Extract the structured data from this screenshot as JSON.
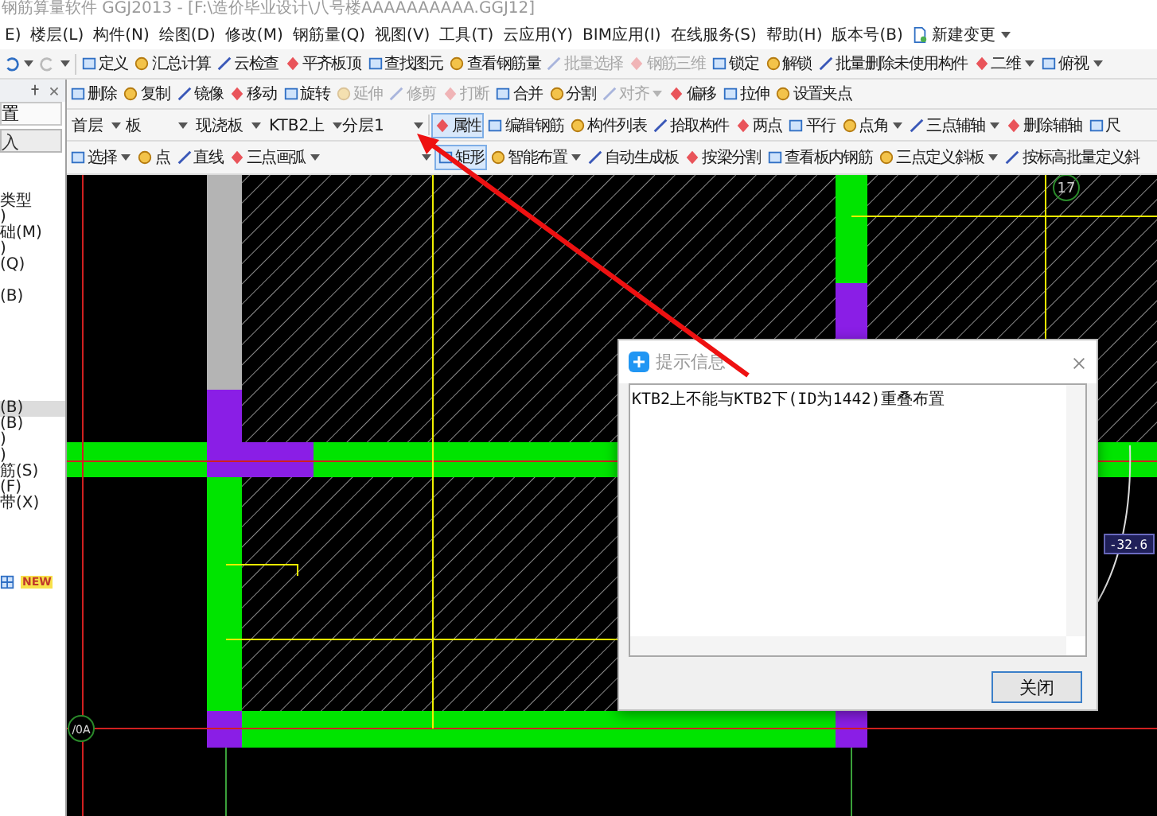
{
  "window": {
    "title": "钢筋算量软件 GGJ2013 - [F:\\造价毕业设计\\八号楼AAAAAAAAAA.GGJ12]"
  },
  "menu": [
    "E)",
    "楼层(L)",
    "构件(N)",
    "绘图(D)",
    "修改(M)",
    "钢筋量(Q)",
    "视图(V)",
    "工具(T)",
    "云应用(Y)",
    "BIM应用(I)",
    "在线服务(S)",
    "帮助(H)",
    "版本号(B)",
    "新建变更"
  ],
  "toolbar_main": [
    {
      "label": "定义",
      "disabled": false,
      "selected": false,
      "dropdown": false
    },
    {
      "label": "汇总计算",
      "disabled": false,
      "selected": false,
      "dropdown": false
    },
    {
      "label": "云检查",
      "disabled": false,
      "selected": false,
      "dropdown": false
    },
    {
      "label": "平齐板顶",
      "disabled": false,
      "selected": false,
      "dropdown": false
    },
    {
      "label": "查找图元",
      "disabled": false,
      "selected": false,
      "dropdown": false
    },
    {
      "label": "查看钢筋量",
      "disabled": false,
      "selected": false,
      "dropdown": false
    },
    {
      "label": "批量选择",
      "disabled": true,
      "selected": false,
      "dropdown": false
    },
    {
      "label": "钢筋三维",
      "disabled": true,
      "selected": false,
      "dropdown": false
    },
    {
      "label": "锁定",
      "disabled": false,
      "selected": false,
      "dropdown": false
    },
    {
      "label": "解锁",
      "disabled": false,
      "selected": false,
      "dropdown": false
    },
    {
      "label": "批量删除未使用构件",
      "disabled": false,
      "selected": false,
      "dropdown": false
    },
    {
      "label": "二维",
      "disabled": false,
      "selected": false,
      "dropdown": true
    },
    {
      "label": "俯视",
      "disabled": false,
      "selected": false,
      "dropdown": true
    }
  ],
  "panel": {
    "title": "置",
    "button": "入",
    "groups": [
      {
        "items": [
          {
            "label": "类型",
            "selected": false
          },
          {
            "label": ")",
            "selected": false
          },
          {
            "label": "础(M)",
            "selected": false
          },
          {
            "label": ")",
            "selected": false
          },
          {
            "label": "(Q)",
            "selected": false
          }
        ]
      },
      {
        "items": [
          {
            "label": "(B)",
            "selected": false
          }
        ]
      },
      {
        "items": [
          {
            "label": "(B)",
            "selected": true
          },
          {
            "label": "(B)",
            "selected": false
          },
          {
            "label": ")",
            "selected": false
          },
          {
            "label": ")",
            "selected": false
          },
          {
            "label": "筋(S)",
            "selected": false
          },
          {
            "label": "(F)",
            "selected": false
          },
          {
            "label": "带(X)",
            "selected": false
          }
        ]
      }
    ],
    "new_badge": "NEW"
  },
  "toolbar_edit": [
    {
      "label": "删除",
      "disabled": false,
      "selected": false,
      "dropdown": false
    },
    {
      "label": "复制",
      "disabled": false,
      "selected": false,
      "dropdown": false
    },
    {
      "label": "镜像",
      "disabled": false,
      "selected": false,
      "dropdown": false
    },
    {
      "label": "移动",
      "disabled": false,
      "selected": false,
      "dropdown": false
    },
    {
      "label": "旋转",
      "disabled": false,
      "selected": false,
      "dropdown": false
    },
    {
      "label": "延伸",
      "disabled": true,
      "selected": false,
      "dropdown": false
    },
    {
      "label": "修剪",
      "disabled": true,
      "selected": false,
      "dropdown": false
    },
    {
      "label": "打断",
      "disabled": true,
      "selected": false,
      "dropdown": false
    },
    {
      "label": "合并",
      "disabled": false,
      "selected": false,
      "dropdown": false
    },
    {
      "label": "分割",
      "disabled": false,
      "selected": false,
      "dropdown": false
    },
    {
      "label": "对齐",
      "disabled": true,
      "selected": false,
      "dropdown": true
    },
    {
      "label": "偏移",
      "disabled": false,
      "selected": false,
      "dropdown": false
    },
    {
      "label": "拉伸",
      "disabled": false,
      "selected": false,
      "dropdown": false
    },
    {
      "label": "设置夹点",
      "disabled": false,
      "selected": false,
      "dropdown": false
    }
  ],
  "selectors": [
    {
      "value": "首层"
    },
    {
      "value": "板"
    },
    {
      "value": "现浇板"
    },
    {
      "value": "KTB2上"
    },
    {
      "value": "分层1"
    }
  ],
  "toolbar_element": [
    {
      "label": "属性",
      "disabled": false,
      "selected": true,
      "dropdown": false
    },
    {
      "label": "编辑钢筋",
      "disabled": false,
      "selected": false,
      "dropdown": false
    },
    {
      "label": "构件列表",
      "disabled": false,
      "selected": false,
      "dropdown": false
    },
    {
      "label": "拾取构件",
      "disabled": false,
      "selected": false,
      "dropdown": false
    },
    {
      "label": "两点",
      "disabled": false,
      "selected": false,
      "dropdown": false
    },
    {
      "label": "平行",
      "disabled": false,
      "selected": false,
      "dropdown": false
    },
    {
      "label": "点角",
      "disabled": false,
      "selected": false,
      "dropdown": true
    },
    {
      "label": "三点辅轴",
      "disabled": false,
      "selected": false,
      "dropdown": true
    },
    {
      "label": "删除辅轴",
      "disabled": false,
      "selected": false,
      "dropdown": false
    },
    {
      "label": "尺",
      "disabled": false,
      "selected": false,
      "dropdown": false
    }
  ],
  "toolbar_draw": [
    {
      "label": "选择",
      "disabled": false,
      "selected": false,
      "dropdown": true
    },
    {
      "label": "点",
      "disabled": false,
      "selected": false,
      "dropdown": false
    },
    {
      "label": "直线",
      "disabled": false,
      "selected": false,
      "dropdown": false
    },
    {
      "label": "三点画弧",
      "disabled": false,
      "selected": false,
      "dropdown": true
    },
    {
      "label": "矩形",
      "disabled": false,
      "selected": true,
      "dropdown": false
    },
    {
      "label": "智能布置",
      "disabled": false,
      "selected": false,
      "dropdown": true
    },
    {
      "label": "自动生成板",
      "disabled": false,
      "selected": false,
      "dropdown": false
    },
    {
      "label": "按梁分割",
      "disabled": false,
      "selected": false,
      "dropdown": false
    },
    {
      "label": "查看板内钢筋",
      "disabled": false,
      "selected": false,
      "dropdown": false
    },
    {
      "label": "三点定义斜板",
      "disabled": false,
      "selected": false,
      "dropdown": true
    },
    {
      "label": "按标高批量定义斜",
      "disabled": false,
      "selected": false,
      "dropdown": false
    }
  ],
  "canvas": {
    "axis_labels": [
      "17",
      "/0A"
    ],
    "dimension": "-32.6"
  },
  "dialog": {
    "title": "提示信息",
    "message": "KTB2上不能与KTB2下(ID为1442)重叠布置",
    "button": "关闭"
  }
}
